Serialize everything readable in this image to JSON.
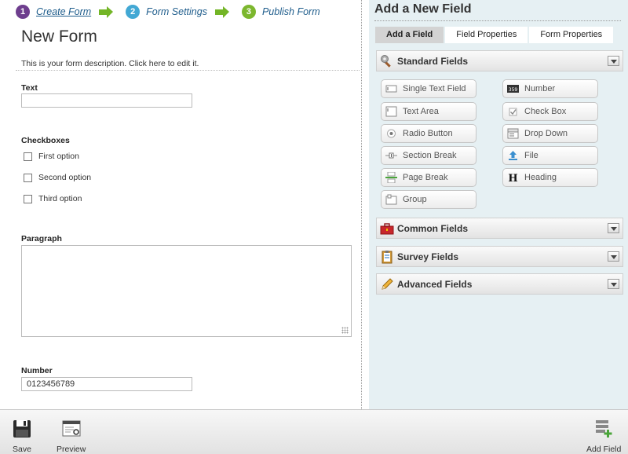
{
  "steps": [
    {
      "num": "1",
      "label": "Create Form"
    },
    {
      "num": "2",
      "label": "Form Settings"
    },
    {
      "num": "3",
      "label": "Publish Form"
    }
  ],
  "form": {
    "title": "New Form",
    "description": "This is your form description. Click here to edit it.",
    "text_field": {
      "label": "Text",
      "value": ""
    },
    "checkboxes": {
      "label": "Checkboxes",
      "options": [
        "First option",
        "Second option",
        "Third option"
      ]
    },
    "paragraph": {
      "label": "Paragraph"
    },
    "number_field": {
      "label": "Number",
      "value": "0123456789"
    }
  },
  "right_panel": {
    "title": "Add a New Field",
    "tabs": [
      "Add a Field",
      "Field Properties",
      "Form Properties"
    ],
    "active_tab": "Add a Field",
    "sections": {
      "standard": "Standard Fields",
      "common": "Common Fields",
      "survey": "Survey Fields",
      "advanced": "Advanced Fields"
    },
    "standard_fields": [
      {
        "label": "Single Text Field",
        "icon": "single-text-icon"
      },
      {
        "label": "Number",
        "icon": "number-icon",
        "icon_text": "359"
      },
      {
        "label": "Text Area",
        "icon": "text-area-icon"
      },
      {
        "label": "Check Box",
        "icon": "check-box-icon"
      },
      {
        "label": "Radio Button",
        "icon": "radio-button-icon"
      },
      {
        "label": "Drop Down",
        "icon": "drop-down-icon"
      },
      {
        "label": "Section Break",
        "icon": "section-break-icon"
      },
      {
        "label": "File",
        "icon": "file-upload-icon"
      },
      {
        "label": "Page Break",
        "icon": "page-break-icon"
      },
      {
        "label": "Heading",
        "icon": "heading-icon",
        "icon_text": "H"
      },
      {
        "label": "Group",
        "icon": "group-icon"
      }
    ]
  },
  "toolbar": {
    "save": "Save",
    "preview": "Preview",
    "add_field": "Add Field"
  },
  "colors": {
    "step1": "#6e3e8e",
    "step2": "#42a8d4",
    "step3": "#7cb72e",
    "link": "#1f5d8c",
    "panel_bg": "#e6f0f3"
  }
}
